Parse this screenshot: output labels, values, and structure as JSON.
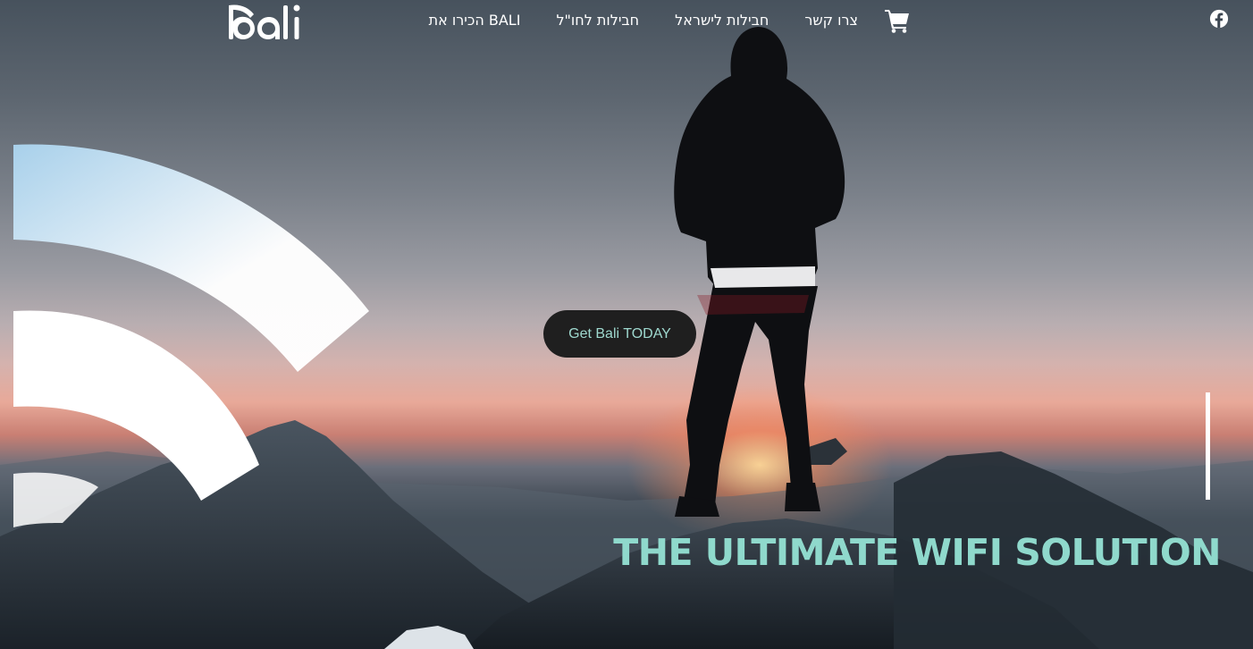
{
  "brand": {
    "logo_text": "bali"
  },
  "nav": {
    "items": [
      {
        "label": "צרו קשר"
      },
      {
        "label": "חבילות לישראל"
      },
      {
        "label": "חבילות לחו\"ל"
      },
      {
        "label": "הכירו את BALI"
      }
    ]
  },
  "hero": {
    "cta_label": "Get Bali TODAY",
    "tagline": "THE ULTIMATE WIFI SOLUTION"
  },
  "icons": {
    "cart": "cart-icon",
    "social": "facebook-icon"
  },
  "colors": {
    "accent": "#8fd9cc",
    "button_bg": "#1f1f1f",
    "button_text": "#9fd9cf"
  }
}
